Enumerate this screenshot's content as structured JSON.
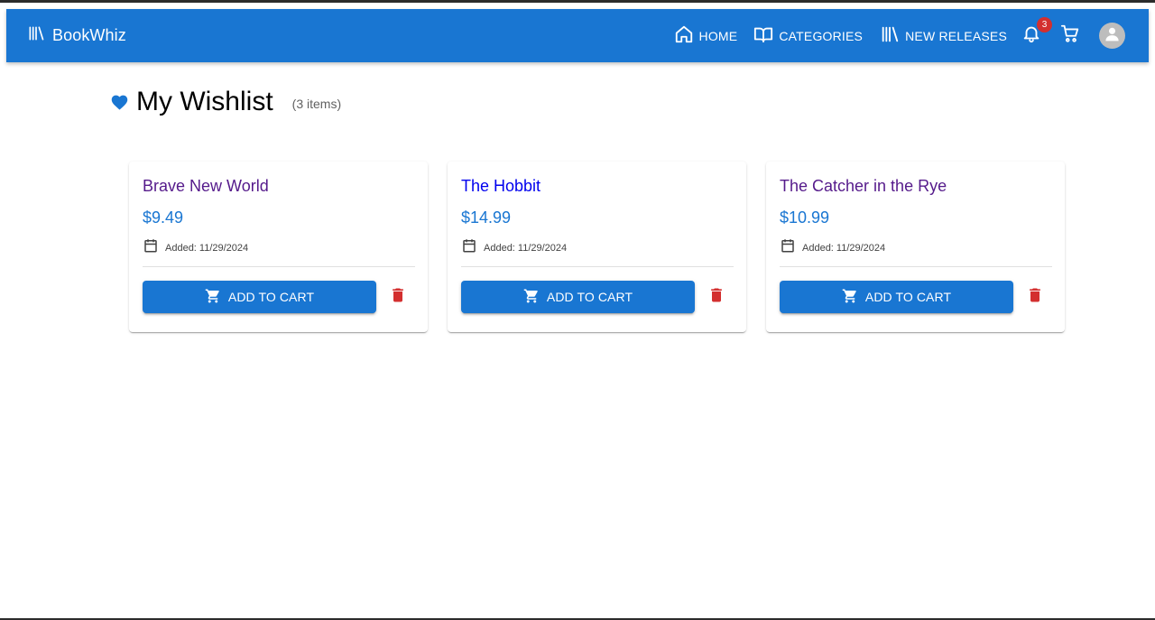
{
  "app": {
    "title": "BookWhiz",
    "logo_icon": "library-icon"
  },
  "nav": {
    "items": [
      {
        "label": "HOME",
        "icon": "home-icon"
      },
      {
        "label": "CATEGORIES",
        "icon": "book-open-icon"
      },
      {
        "label": "NEW RELEASES",
        "icon": "library-icon"
      }
    ],
    "notifications": {
      "icon": "bell-icon",
      "count": "3"
    },
    "cart": {
      "icon": "cart-icon"
    },
    "account": {
      "icon": "avatar-icon"
    }
  },
  "page": {
    "title": "My Wishlist",
    "title_icon": "heart-icon",
    "count_text": "(3 items)"
  },
  "wishlist": [
    {
      "title": "Brave New World",
      "price": "$9.49",
      "added": "Added: 11/29/2024",
      "button": "ADD TO CART"
    },
    {
      "title": "The Hobbit",
      "price": "$14.99",
      "added": "Added: 11/29/2024",
      "button": "ADD TO CART"
    },
    {
      "title": "The Catcher in the Rye",
      "price": "$10.99",
      "added": "Added: 11/29/2024",
      "button": "ADD TO CART"
    }
  ],
  "colors": {
    "primary": "#1976d2",
    "danger": "#d32f2f",
    "visited_link": "#551a8b",
    "unvisited_link": "#0000ee"
  }
}
